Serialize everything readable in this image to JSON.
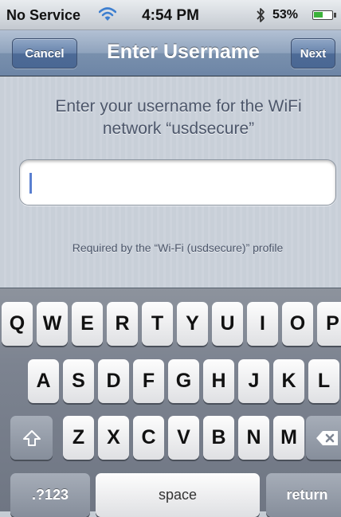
{
  "status_bar": {
    "carrier": "No Service",
    "time": "4:54 PM",
    "battery_percent": "53%",
    "battery_level": 0.53,
    "icons": [
      "wifi-icon",
      "bluetooth-icon",
      "battery-icon"
    ]
  },
  "nav": {
    "cancel_label": "Cancel",
    "title": "Enter Username",
    "next_label": "Next"
  },
  "content": {
    "prompt": "Enter your username for the WiFi network “usdsecure”",
    "username_value": "",
    "profile_note": "Required by the “Wi-Fi (usdsecure)” profile"
  },
  "keyboard": {
    "row1": [
      "Q",
      "W",
      "E",
      "R",
      "T",
      "Y",
      "U",
      "I",
      "O",
      "P"
    ],
    "row2": [
      "A",
      "S",
      "D",
      "F",
      "G",
      "H",
      "J",
      "K",
      "L"
    ],
    "row3": [
      "Z",
      "X",
      "C",
      "V",
      "B",
      "N",
      "M"
    ],
    "numbers_label": ".?123",
    "space_label": "space",
    "return_label": "return",
    "icons": [
      "shift-icon",
      "backspace-icon"
    ]
  },
  "colors": {
    "nav_blue": "#6d85a6",
    "keyboard_gray": "#7c8390",
    "caret_blue": "#5a7fd0"
  }
}
